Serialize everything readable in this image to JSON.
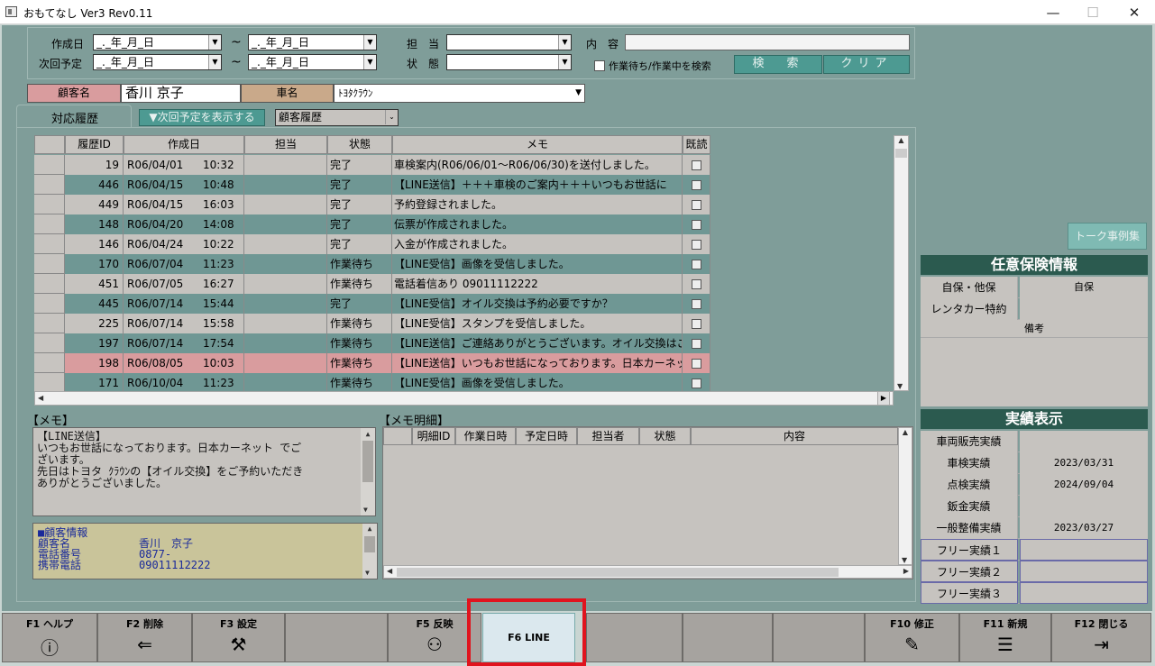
{
  "window": {
    "title": "おもてなし Ver3 Rev0.11",
    "min": "—",
    "max": "☐",
    "close": "✕"
  },
  "search": {
    "created_label": "作成日",
    "next_label": "次回予定",
    "date_placeholder": "_._年_月_日",
    "tilde": "~",
    "staff_label": "担　当",
    "status_label": "状　態",
    "content_label": "内　容",
    "waiting_label": "作業待ち/作業中を検索",
    "search_btn": "検　索",
    "clear_btn": "クリア"
  },
  "customer": {
    "name_label": "顧客名",
    "name": "香川 京子",
    "car_label": "車名",
    "car": "ﾄﾖﾀｸﾗｳﾝ"
  },
  "tabs": {
    "history_tab": "対応履歴",
    "show_next_btn": "▼次回予定を表示する",
    "history_combo": "顧客履歴"
  },
  "history": {
    "columns": [
      "履歴ID",
      "作成日",
      "担当",
      "状態",
      "メモ",
      "既読"
    ],
    "rows": [
      {
        "id": "19",
        "date": "R06/04/01",
        "time": "10:32",
        "staff": "",
        "status": "完了",
        "memo": "車検案内(R06/06/01～R06/06/30)を送付しました。"
      },
      {
        "id": "446",
        "date": "R06/04/15",
        "time": "10:48",
        "staff": "",
        "status": "完了",
        "memo": "【LINE送信】＋＋＋車検のご案内＋＋＋いつもお世話に"
      },
      {
        "id": "449",
        "date": "R06/04/15",
        "time": "16:03",
        "staff": "",
        "status": "完了",
        "memo": "予約登録されました。"
      },
      {
        "id": "148",
        "date": "R06/04/20",
        "time": "14:08",
        "staff": "",
        "status": "完了",
        "memo": "伝票が作成されました。"
      },
      {
        "id": "146",
        "date": "R06/04/24",
        "time": "10:22",
        "staff": "",
        "status": "完了",
        "memo": "入金が作成されました。"
      },
      {
        "id": "170",
        "date": "R06/07/04",
        "time": "11:23",
        "staff": "",
        "status": "作業待ち",
        "memo": "【LINE受信】画像を受信しました。"
      },
      {
        "id": "451",
        "date": "R06/07/05",
        "time": "16:27",
        "staff": "",
        "status": "作業待ち",
        "memo": "電話着信あり 09011112222"
      },
      {
        "id": "445",
        "date": "R06/07/14",
        "time": "15:44",
        "staff": "",
        "status": "完了",
        "memo": "【LINE受信】オイル交換は予約必要ですか？"
      },
      {
        "id": "225",
        "date": "R06/07/14",
        "time": "15:58",
        "staff": "",
        "status": "作業待ち",
        "memo": "【LINE受信】スタンプを受信しました。"
      },
      {
        "id": "197",
        "date": "R06/07/14",
        "time": "17:54",
        "staff": "",
        "status": "作業待ち",
        "memo": "【LINE送信】ご連絡ありがとうございます。オイル交換はご"
      },
      {
        "id": "198",
        "date": "R06/08/05",
        "time": "10:03",
        "staff": "",
        "status": "作業待ち",
        "memo": "【LINE送信】いつもお世話になっております。日本カーネッ"
      },
      {
        "id": "171",
        "date": "R06/10/04",
        "time": "11:23",
        "staff": "",
        "status": "作業待ち",
        "memo": "【LINE受信】画像を受信しました。"
      }
    ]
  },
  "memo": {
    "label": "【メモ】",
    "line1": "【LINE送信】",
    "line2": "いつもお世話になっております。日本カーネット でご",
    "line3": "ざいます。",
    "line4": "先日はトヨタ ｸﾗｳﾝの【オイル交換】をご予約いただき",
    "line5": "ありがとうございました。"
  },
  "custinfo": {
    "title": "■顧客情報",
    "name_k": "顧客名",
    "name_v": "香川　京子",
    "tel_k": "電話番号",
    "tel_v": "0877-",
    "mobile_k": "携帯電話",
    "mobile_v": "09011112222"
  },
  "memo_detail": {
    "label": "【メモ明細】",
    "columns": [
      "明細ID",
      "作業日時",
      "予定日時",
      "担当者",
      "状態",
      "内容"
    ]
  },
  "side": {
    "talk_btn": "トーク事例集",
    "ins_header": "任意保険情報",
    "ins_rows": [
      {
        "k": "自保・他保",
        "v": "自保"
      },
      {
        "k": "レンタカー特約",
        "v": ""
      }
    ],
    "remarks": "備考",
    "perf_header": "実績表示",
    "perf_rows": [
      {
        "k": "車両販売実績",
        "v": ""
      },
      {
        "k": "車検実績",
        "v": "2023/03/31"
      },
      {
        "k": "点検実績",
        "v": "2024/09/04"
      },
      {
        "k": "鈑金実績",
        "v": ""
      },
      {
        "k": "一般整備実績",
        "v": "2023/03/27"
      }
    ],
    "free_rows": [
      {
        "k": "フリー実績１",
        "v": ""
      },
      {
        "k": "フリー実績２",
        "v": ""
      },
      {
        "k": "フリー実績３",
        "v": ""
      }
    ]
  },
  "fkeys": {
    "f1": "F1 ヘルプ",
    "f2": "F2 削除",
    "f3": "F3 設定",
    "f5": "F5 反映",
    "f6": "F6 LINE",
    "f10": "F10 修正",
    "f11": "F11 新規",
    "f12": "F12 閉じる"
  },
  "colors": {
    "teal": "#7f9d99",
    "row_light": "#c6c3bf",
    "row_dark": "#6f9794",
    "row_selected": "#d99c9e",
    "highlight": "#e0141e",
    "header_green": "#2b5a4f"
  }
}
